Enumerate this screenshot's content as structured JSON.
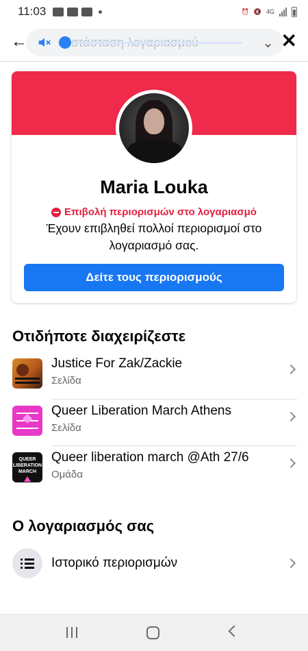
{
  "status_bar": {
    "time": "11:03",
    "network_label": "4G"
  },
  "header": {
    "title": "Κατάσταση λογαριασμού",
    "back_icon": "arrow-left-icon",
    "close_icon": "close-icon",
    "media_overlay": {
      "mute_icon": "speaker-muted-icon",
      "expand_icon": "chevron-down-icon"
    }
  },
  "profile": {
    "name": "Maria Louka",
    "restriction_label": "Επιβολή περιορισμών στο λογαριασμό",
    "restriction_description": "Έχουν επιβληθεί πολλοί περιορισμοί στο λογαριασμό σας.",
    "button_label": "Δείτε τους περιορισμούς",
    "banner_color": "#ef2a4a",
    "accent_color": "#1877f2",
    "warning_color": "#e41e3f"
  },
  "managed": {
    "title": "Οτιδήποτε διαχειρίζεστε",
    "items": [
      {
        "title": "Justice For Zak/Zackie",
        "subtitle": "Σελίδα"
      },
      {
        "title": "Queer Liberation March Athens",
        "subtitle": "Σελίδα"
      },
      {
        "title": "Queer liberation march @Ath 27/6",
        "subtitle": "Ομάδα",
        "thumb_text_1": "QUEER",
        "thumb_text_2": "LIBERATION",
        "thumb_text_3": "MARCH"
      }
    ]
  },
  "account": {
    "title": "Ο λογαριασμός σας",
    "items": [
      {
        "title": "Ιστορικό περιορισμών",
        "icon": "list-icon"
      }
    ]
  },
  "nav_bar": {
    "recent_icon": "recent-apps-icon",
    "home_icon": "home-icon",
    "back_icon": "back-icon"
  }
}
